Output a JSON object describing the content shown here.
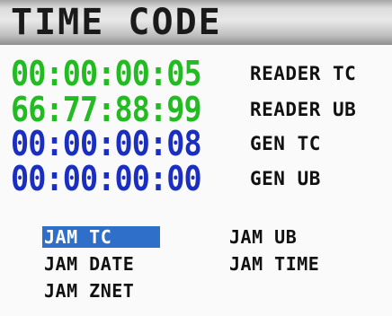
{
  "title": "TIME CODE",
  "colors": {
    "reader": "#22bb22",
    "generator": "#1a2fbf",
    "selection": "#2f6fc9"
  },
  "timecodes": [
    {
      "value": "00:00:00:05",
      "label": "READER TC",
      "color": "#22bb22"
    },
    {
      "value": "66:77:88:99",
      "label": "READER UB",
      "color": "#22bb22"
    },
    {
      "value": "00:00:00:08",
      "label": "GEN TC",
      "color": "#1a2fbf"
    },
    {
      "value": "00:00:00:00",
      "label": "GEN UB",
      "color": "#1a2fbf"
    }
  ],
  "menu": {
    "jam_tc": "JAM TC",
    "jam_ub": "JAM UB",
    "jam_date": "JAM DATE",
    "jam_time": "JAM TIME",
    "jam_znet": "JAM ZNET",
    "selected": "JAM TC"
  }
}
